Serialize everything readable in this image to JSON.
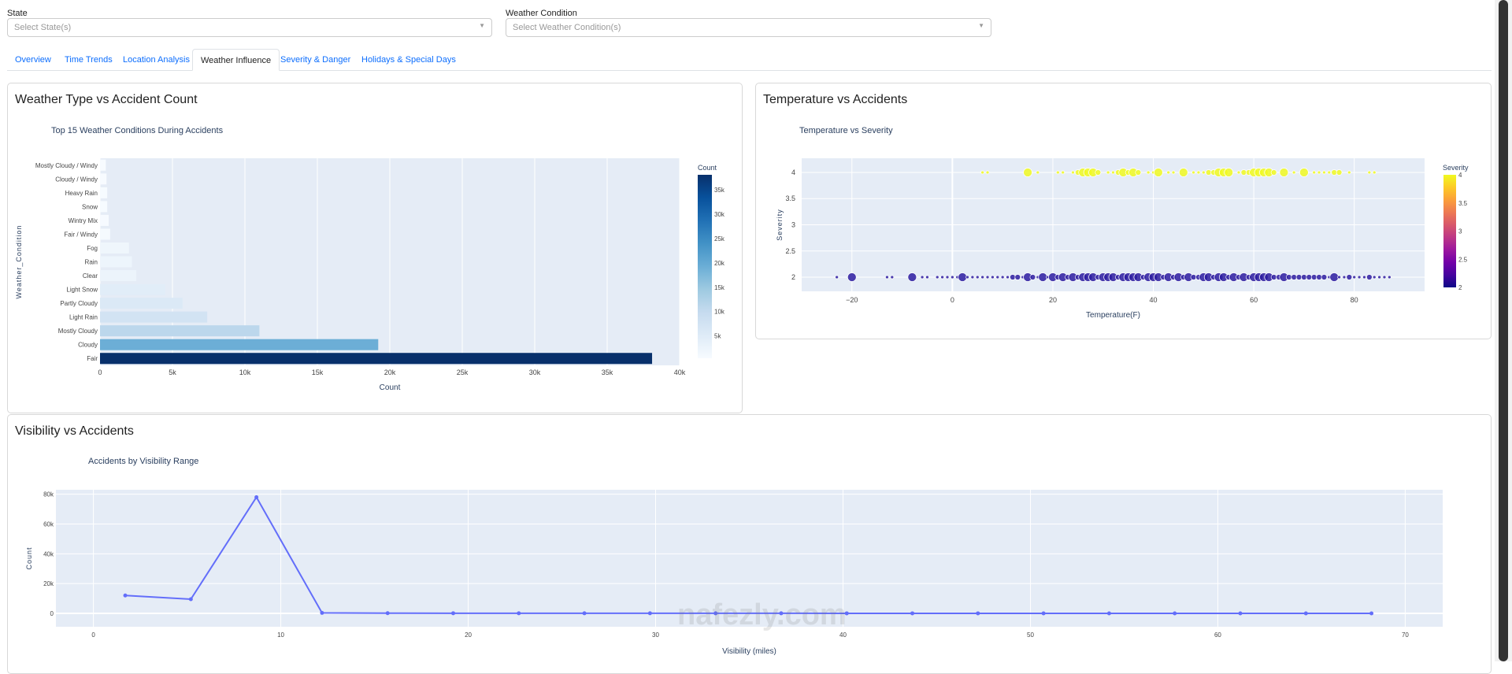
{
  "filters": {
    "state": {
      "label": "State",
      "placeholder": "Select State(s)"
    },
    "weather": {
      "label": "Weather Condition",
      "placeholder": "Select Weather Condition(s)"
    }
  },
  "tabs": [
    {
      "label": "Overview",
      "active": false
    },
    {
      "label": "Time Trends",
      "active": false
    },
    {
      "label": "Location Analysis",
      "active": false
    },
    {
      "label": "Weather Influence",
      "active": true
    },
    {
      "label": "Severity & Danger",
      "active": false
    },
    {
      "label": "Holidays & Special Days",
      "active": false
    }
  ],
  "cards": {
    "weather_type": "Weather Type vs Accident Count",
    "temperature": "Temperature vs Accidents",
    "visibility": "Visibility vs Accidents"
  },
  "watermark": "nafezly.com",
  "chart_data": [
    {
      "type": "bar",
      "orientation": "horizontal",
      "title": "Top 15 Weather Conditions During Accidents",
      "xlabel": "Count",
      "ylabel": "Weather_Condition",
      "xlim": [
        0,
        40000
      ],
      "xticks": [
        "0",
        "5k",
        "10k",
        "15k",
        "20k",
        "25k",
        "30k",
        "35k",
        "40k"
      ],
      "categories": [
        "Fair",
        "Cloudy",
        "Mostly Cloudy",
        "Light Rain",
        "Partly Cloudy",
        "Light Snow",
        "Clear",
        "Rain",
        "Fog",
        "Fair / Windy",
        "Wintry Mix",
        "Snow",
        "Heavy Rain",
        "Cloudy / Windy",
        "Mostly Cloudy / Windy"
      ],
      "values": [
        38100,
        19200,
        11000,
        7400,
        5700,
        4500,
        2500,
        2200,
        2000,
        700,
        600,
        500,
        500,
        450,
        400
      ],
      "colorbar": {
        "title": "Count",
        "ticks": [
          "5k",
          "10k",
          "15k",
          "20k",
          "25k",
          "30k",
          "35k"
        ],
        "colorscale": "Blues",
        "range": [
          400,
          38100
        ]
      },
      "grid": true
    },
    {
      "type": "scatter",
      "title": "Temperature vs Severity",
      "xlabel": "Temperature(F)",
      "ylabel": "Severity",
      "xlim": [
        -30,
        94
      ],
      "ylim": [
        1.73,
        4.27
      ],
      "xticks": [
        "−20",
        "0",
        "20",
        "40",
        "60",
        "80"
      ],
      "yticks": [
        "2",
        "2.5",
        "3",
        "3.5",
        "4"
      ],
      "colorbar": {
        "title": "Severity",
        "ticks": [
          "2",
          "2.5",
          "3",
          "3.5",
          "4"
        ],
        "colorscale": "Plasma",
        "range": [
          2,
          4
        ]
      },
      "points": [
        [
          6,
          4,
          1
        ],
        [
          7,
          4,
          1
        ],
        [
          15,
          4,
          3
        ],
        [
          17,
          4,
          1
        ],
        [
          21,
          4,
          1
        ],
        [
          22,
          4,
          1
        ],
        [
          24,
          4,
          1
        ],
        [
          25,
          4,
          2
        ],
        [
          26,
          4,
          3
        ],
        [
          27,
          4,
          3
        ],
        [
          28,
          4,
          3
        ],
        [
          29,
          4,
          2
        ],
        [
          31,
          4,
          1
        ],
        [
          32,
          4,
          1
        ],
        [
          33,
          4,
          2
        ],
        [
          34,
          4,
          3
        ],
        [
          35,
          4,
          2
        ],
        [
          36,
          4,
          3
        ],
        [
          37,
          4,
          2
        ],
        [
          39,
          4,
          1
        ],
        [
          40,
          4,
          1
        ],
        [
          41,
          4,
          3
        ],
        [
          43,
          4,
          1
        ],
        [
          44,
          4,
          1
        ],
        [
          46,
          4,
          3
        ],
        [
          48,
          4,
          1
        ],
        [
          49,
          4,
          1
        ],
        [
          50,
          4,
          1
        ],
        [
          51,
          4,
          2
        ],
        [
          52,
          4,
          2
        ],
        [
          53,
          4,
          3
        ],
        [
          54,
          4,
          3
        ],
        [
          55,
          4,
          3
        ],
        [
          57,
          4,
          1
        ],
        [
          58,
          4,
          2
        ],
        [
          59,
          4,
          2
        ],
        [
          60,
          4,
          3
        ],
        [
          61,
          4,
          3
        ],
        [
          62,
          4,
          3
        ],
        [
          63,
          4,
          3
        ],
        [
          64,
          4,
          2
        ],
        [
          66,
          4,
          3
        ],
        [
          68,
          4,
          1
        ],
        [
          70,
          4,
          3
        ],
        [
          72,
          4,
          1
        ],
        [
          73,
          4,
          1
        ],
        [
          74,
          4,
          1
        ],
        [
          75,
          4,
          1
        ],
        [
          76,
          4,
          2
        ],
        [
          77,
          4,
          2
        ],
        [
          79,
          4,
          1
        ],
        [
          83,
          4,
          1
        ],
        [
          84,
          4,
          1
        ],
        [
          -23,
          2,
          1
        ],
        [
          -20,
          2,
          3
        ],
        [
          -13,
          2,
          1
        ],
        [
          -12,
          2,
          1
        ],
        [
          -8,
          2,
          3
        ],
        [
          -6,
          2,
          1
        ],
        [
          -5,
          2,
          1
        ],
        [
          -3,
          2,
          1
        ],
        [
          -2,
          2,
          1
        ],
        [
          -1,
          2,
          1
        ],
        [
          0,
          2,
          1
        ],
        [
          1,
          2,
          1
        ],
        [
          2,
          2,
          3
        ],
        [
          3,
          2,
          1
        ],
        [
          4,
          2,
          1
        ],
        [
          5,
          2,
          1
        ],
        [
          6,
          2,
          1
        ],
        [
          7,
          2,
          1
        ],
        [
          8,
          2,
          1
        ],
        [
          9,
          2,
          1
        ],
        [
          10,
          2,
          1
        ],
        [
          11,
          2,
          1
        ],
        [
          12,
          2,
          2
        ],
        [
          13,
          2,
          2
        ],
        [
          14,
          2,
          1
        ],
        [
          15,
          2,
          3
        ],
        [
          16,
          2,
          2
        ],
        [
          17,
          2,
          1
        ],
        [
          18,
          2,
          3
        ],
        [
          19,
          2,
          1
        ],
        [
          20,
          2,
          3
        ],
        [
          21,
          2,
          2
        ],
        [
          22,
          2,
          3
        ],
        [
          23,
          2,
          2
        ],
        [
          24,
          2,
          3
        ],
        [
          25,
          2,
          2
        ],
        [
          26,
          2,
          3
        ],
        [
          27,
          2,
          3
        ],
        [
          28,
          2,
          3
        ],
        [
          29,
          2,
          2
        ],
        [
          30,
          2,
          3
        ],
        [
          31,
          2,
          3
        ],
        [
          32,
          2,
          3
        ],
        [
          33,
          2,
          2
        ],
        [
          34,
          2,
          3
        ],
        [
          35,
          2,
          3
        ],
        [
          36,
          2,
          3
        ],
        [
          37,
          2,
          3
        ],
        [
          38,
          2,
          2
        ],
        [
          39,
          2,
          3
        ],
        [
          40,
          2,
          3
        ],
        [
          41,
          2,
          3
        ],
        [
          42,
          2,
          2
        ],
        [
          43,
          2,
          3
        ],
        [
          44,
          2,
          2
        ],
        [
          45,
          2,
          3
        ],
        [
          46,
          2,
          2
        ],
        [
          47,
          2,
          3
        ],
        [
          48,
          2,
          2
        ],
        [
          49,
          2,
          2
        ],
        [
          50,
          2,
          3
        ],
        [
          51,
          2,
          3
        ],
        [
          52,
          2,
          2
        ],
        [
          53,
          2,
          3
        ],
        [
          54,
          2,
          3
        ],
        [
          55,
          2,
          2
        ],
        [
          56,
          2,
          3
        ],
        [
          57,
          2,
          2
        ],
        [
          58,
          2,
          3
        ],
        [
          59,
          2,
          2
        ],
        [
          60,
          2,
          3
        ],
        [
          61,
          2,
          3
        ],
        [
          62,
          2,
          3
        ],
        [
          63,
          2,
          3
        ],
        [
          64,
          2,
          2
        ],
        [
          65,
          2,
          2
        ],
        [
          66,
          2,
          3
        ],
        [
          67,
          2,
          2
        ],
        [
          68,
          2,
          2
        ],
        [
          69,
          2,
          2
        ],
        [
          70,
          2,
          2
        ],
        [
          71,
          2,
          2
        ],
        [
          72,
          2,
          2
        ],
        [
          73,
          2,
          2
        ],
        [
          74,
          2,
          2
        ],
        [
          75,
          2,
          1
        ],
        [
          76,
          2,
          3
        ],
        [
          77,
          2,
          1
        ],
        [
          78,
          2,
          1
        ],
        [
          79,
          2,
          2
        ],
        [
          80,
          2,
          1
        ],
        [
          81,
          2,
          1
        ],
        [
          82,
          2,
          1
        ],
        [
          83,
          2,
          2
        ],
        [
          84,
          2,
          1
        ],
        [
          85,
          2,
          1
        ],
        [
          86,
          2,
          1
        ],
        [
          87,
          2,
          1
        ]
      ],
      "grid": true
    },
    {
      "type": "line",
      "title": "Accidents by Visibility Range",
      "xlabel": "Visibility (miles)",
      "ylabel": "Count",
      "xlim": [
        -2,
        72
      ],
      "ylim": [
        -9000,
        83000
      ],
      "xticks": [
        "0",
        "10",
        "20",
        "30",
        "40",
        "50",
        "60",
        "70"
      ],
      "yticks": [
        "0",
        "20k",
        "40k",
        "60k",
        "80k"
      ],
      "x": [
        1.7,
        5.2,
        8.7,
        12.2,
        15.7,
        19.2,
        22.7,
        26.2,
        29.7,
        33.2,
        36.7,
        40.2,
        43.7,
        47.2,
        50.7,
        54.2,
        57.7,
        61.2,
        64.7,
        68.2
      ],
      "y": [
        12000,
        9500,
        78000,
        300,
        100,
        80,
        60,
        50,
        40,
        30,
        30,
        20,
        20,
        20,
        10,
        10,
        10,
        10,
        10,
        10
      ],
      "color": "#636efa",
      "grid": true
    }
  ]
}
